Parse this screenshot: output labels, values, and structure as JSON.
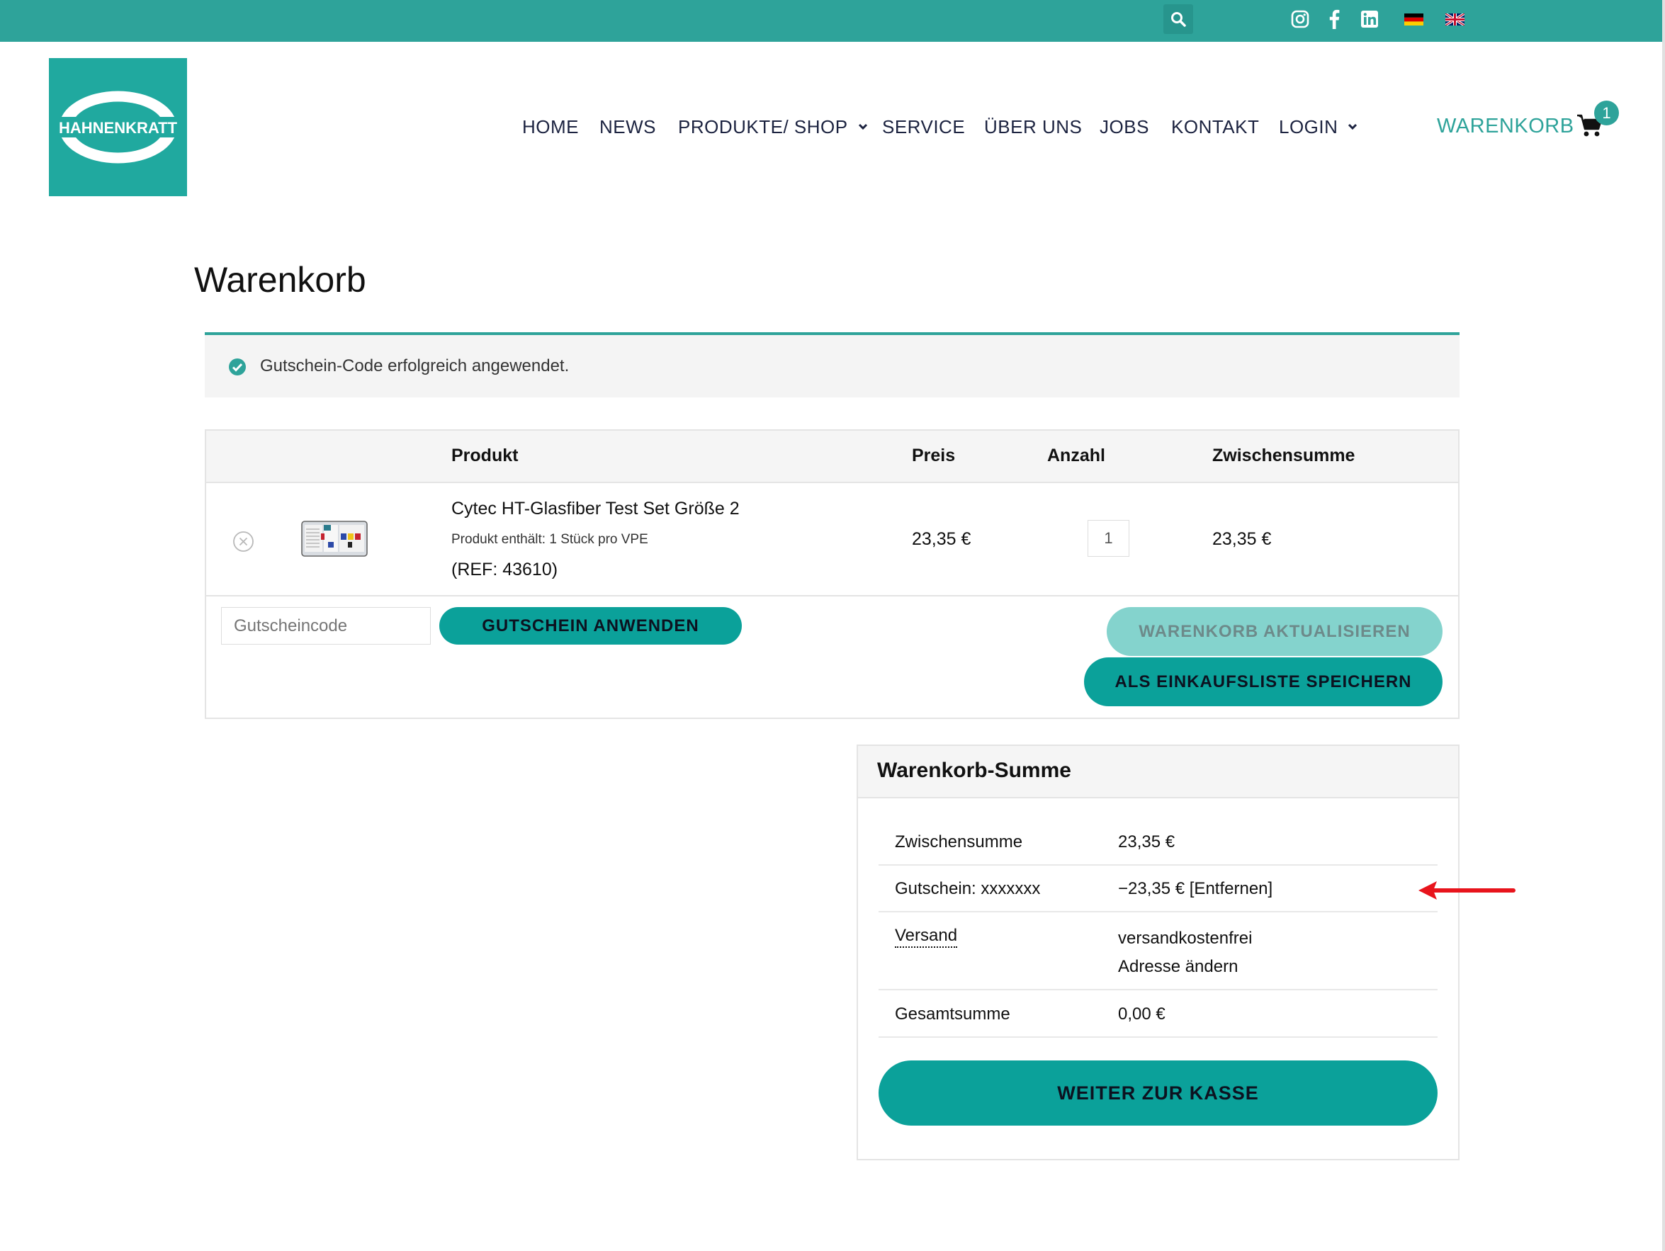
{
  "topbar": {
    "search_icon": "search-icon",
    "social_icons": [
      "instagram-icon",
      "facebook-icon",
      "linkedin-icon"
    ],
    "languages": [
      {
        "name": "german-flag-icon",
        "colors": [
          "#000000",
          "#dd0000",
          "#ffce00"
        ]
      },
      {
        "name": "uk-flag-icon",
        "colors": [
          "#012169",
          "#ffffff",
          "#c8102e"
        ]
      }
    ]
  },
  "logo": {
    "text": "HAHNENKRATT"
  },
  "nav": {
    "items": [
      {
        "label": "HOME"
      },
      {
        "label": "NEWS"
      },
      {
        "label": "PRODUKTE/ SHOP",
        "dropdown": true
      },
      {
        "label": "SERVICE"
      },
      {
        "label": "ÜBER UNS"
      },
      {
        "label": "JOBS"
      },
      {
        "label": "KONTAKT"
      },
      {
        "label": "LOGIN",
        "dropdown": true
      }
    ],
    "cart_label": "WARENKORB",
    "cart_count": "1"
  },
  "page": {
    "title": "Warenkorb"
  },
  "notice": {
    "text": "Gutschein-Code erfolgreich angewendet."
  },
  "cart_table": {
    "headers": {
      "product": "Produkt",
      "price": "Preis",
      "quantity": "Anzahl",
      "subtotal": "Zwischensumme"
    },
    "items": [
      {
        "name": "Cytec HT-Glasfiber Test Set Größe 2",
        "meta": "Produkt enthält: 1 Stück pro VPE",
        "ref": "(REF: 43610)",
        "price": "23,35 €",
        "quantity": "1",
        "subtotal": "23,35 €"
      }
    ],
    "coupon_placeholder": "Gutscheincode",
    "apply_coupon_label": "GUTSCHEIN ANWENDEN",
    "update_cart_label": "WARENKORB AKTUALISIEREN",
    "save_list_label": "ALS EINKAUFSLISTE SPEICHERN"
  },
  "totals": {
    "title": "Warenkorb-Summe",
    "subtotal_label": "Zwischensumme",
    "subtotal_value": "23,35 €",
    "coupon_label": "Gutschein: xxxxxxx",
    "coupon_value": "−23,35 €",
    "coupon_remove": "[Entfernen]",
    "shipping_label": "Versand",
    "shipping_value": "versandkostenfrei",
    "change_address": "Adresse ändern",
    "total_label": "Gesamtsumme",
    "total_value": "0,00 €",
    "checkout_label": "WEITER ZUR KASSE"
  },
  "colors": {
    "accent": "#2ea39a",
    "button": "#0ba19a",
    "button_disabled": "#84d3cd",
    "annotation_arrow": "#e8141c"
  }
}
